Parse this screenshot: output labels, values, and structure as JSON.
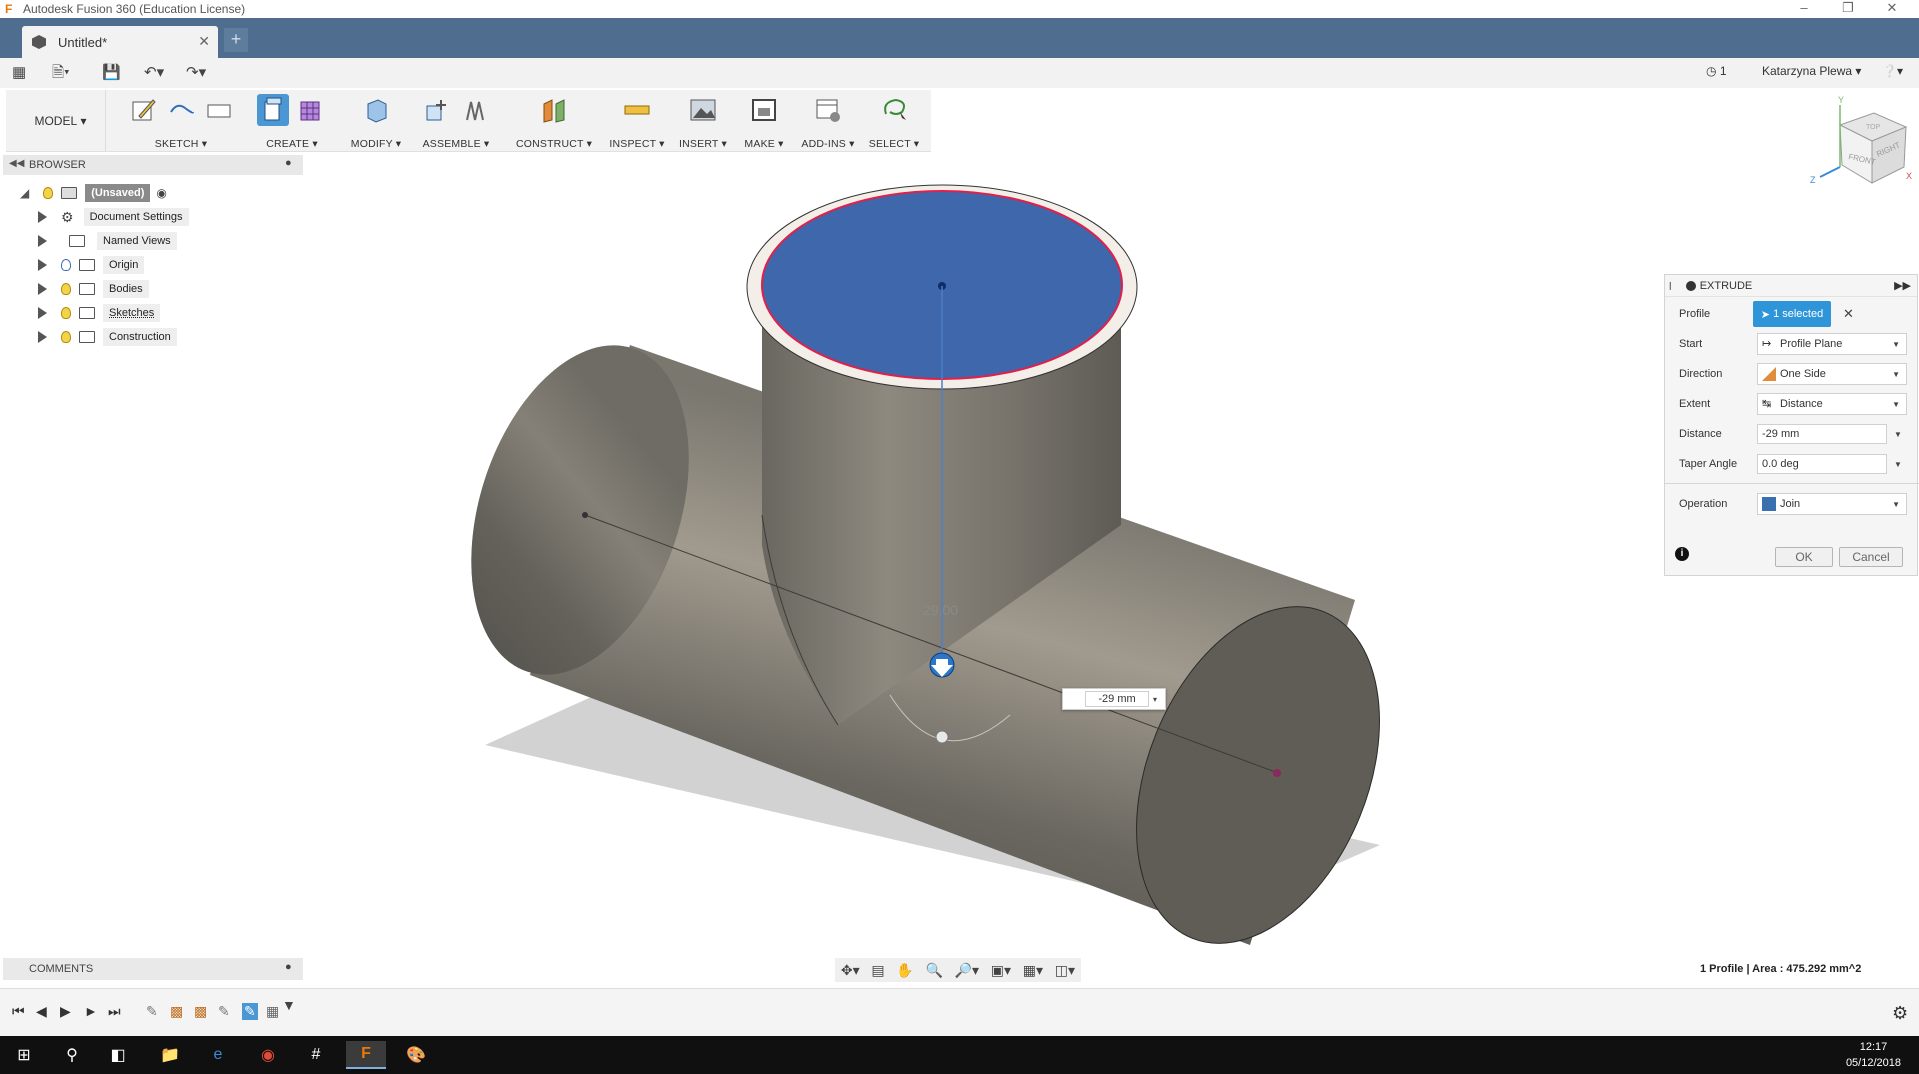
{
  "window": {
    "title": "Autodesk Fusion 360 (Education License)"
  },
  "tabs": [
    {
      "label": "Untitled*"
    }
  ],
  "quickbar": {
    "jobs_count": "1",
    "user_name": "Katarzyna Plewa"
  },
  "ribbon": {
    "workspace": "MODEL",
    "groups": [
      {
        "label": "SKETCH"
      },
      {
        "label": "CREATE"
      },
      {
        "label": "MODIFY"
      },
      {
        "label": "ASSEMBLE"
      },
      {
        "label": "CONSTRUCT"
      },
      {
        "label": "INSPECT"
      },
      {
        "label": "INSERT"
      },
      {
        "label": "MAKE"
      },
      {
        "label": "ADD-INS"
      },
      {
        "label": "SELECT"
      }
    ]
  },
  "browser": {
    "title": "BROWSER",
    "root": "(Unsaved)",
    "items": [
      {
        "label": "Document Settings",
        "icon": "gear-icon"
      },
      {
        "label": "Named Views",
        "icon": "folder-icon"
      },
      {
        "label": "Origin",
        "icon": "folder-icon"
      },
      {
        "label": "Bodies",
        "icon": "folder-icon"
      },
      {
        "label": "Sketches",
        "icon": "folder-icon"
      },
      {
        "label": "Construction",
        "icon": "folder-icon"
      }
    ]
  },
  "viewcube": {
    "front": "FRONT",
    "right": "RIGHT",
    "top": "TOP",
    "axis_x": "X",
    "axis_y": "Y",
    "axis_z": "Z"
  },
  "viewport": {
    "dimension_label": "29.00",
    "distance_input": "-29 mm"
  },
  "extrude": {
    "title": "EXTRUDE",
    "profile_label": "Profile",
    "profile_value": "1 selected",
    "start_label": "Start",
    "start_value": "Profile Plane",
    "direction_label": "Direction",
    "direction_value": "One Side",
    "extent_label": "Extent",
    "extent_value": "Distance",
    "distance_label": "Distance",
    "distance_value": "-29 mm",
    "taper_label": "Taper Angle",
    "taper_value": "0.0 deg",
    "operation_label": "Operation",
    "operation_value": "Join",
    "ok": "OK",
    "cancel": "Cancel"
  },
  "comments": {
    "title": "COMMENTS"
  },
  "status": {
    "text": "1 Profile | Area : 475.292 mm^2"
  },
  "taskbar": {
    "time": "12:17",
    "date": "05/12/2018"
  },
  "colors": {
    "accent": "#2f95d9",
    "tabbar": "#4f6e8f",
    "face_blue": "#3f67ab"
  }
}
